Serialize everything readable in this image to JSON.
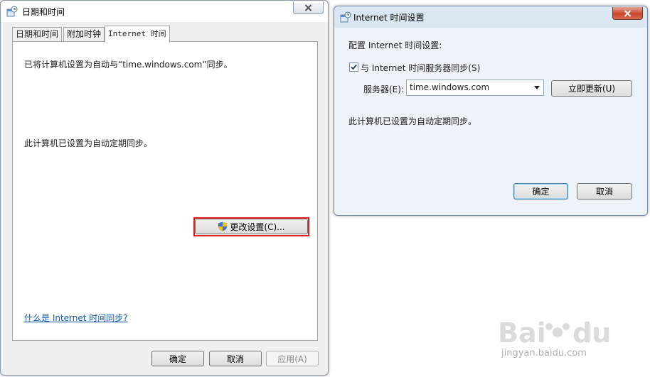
{
  "left_window": {
    "title": "日期和时间",
    "tabs": [
      {
        "label": "日期和时间",
        "active": false
      },
      {
        "label": "附加时钟",
        "active": false
      },
      {
        "label": "Internet 时间",
        "active": true
      }
    ],
    "panel": {
      "sync_status": "已将计算机设置为自动与“time.windows.com”同步。",
      "schedule_status": "此计算机已设置为自动定期同步。",
      "change_settings_button": "更改设置(C)...",
      "help_link": "什么是 Internet 时间同步?"
    },
    "buttons": {
      "ok": "确定",
      "cancel": "取消",
      "apply": "应用(A)"
    }
  },
  "right_window": {
    "title": "Internet 时间设置",
    "heading": "配置 Internet 时间设置:",
    "sync_checkbox": {
      "label": "与 Internet 时间服务器同步(S)",
      "checked": true
    },
    "server_label": "服务器(E):",
    "server_value": "time.windows.com",
    "update_now_button": "立即更新(U)",
    "schedule_status": "此计算机已设置为自动定期同步。",
    "buttons": {
      "ok": "确定",
      "cancel": "取消"
    }
  },
  "watermark": {
    "text": "jingyan.baidu.com"
  },
  "colors": {
    "link": "#0c58b4",
    "highlight": "#e02020"
  }
}
